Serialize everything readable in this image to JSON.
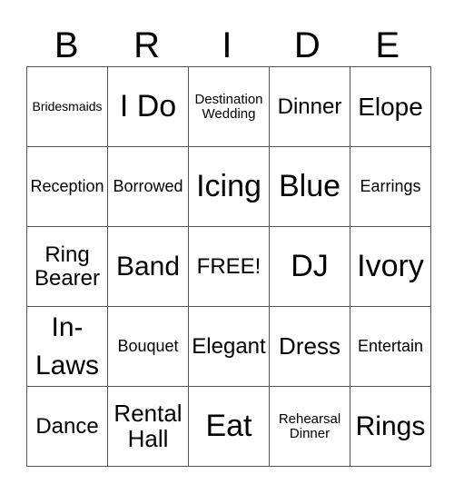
{
  "header": [
    "B",
    "R",
    "I",
    "D",
    "E"
  ],
  "rows": [
    [
      "Bridesmaids",
      "I Do",
      "Destination Wedding",
      "Dinner",
      "Elope"
    ],
    [
      "Reception",
      "Borrowed",
      "Icing",
      "Blue",
      "Earrings"
    ],
    [
      "Ring Bearer",
      "Band",
      "FREE!",
      "DJ",
      "Ivory"
    ],
    [
      "In-Laws",
      "Bouquet",
      "Elegant",
      "Dress",
      "Entertain"
    ],
    [
      "Dance",
      "Rental Hall",
      "Eat",
      "Rehearsal Dinner",
      "Rings"
    ]
  ]
}
